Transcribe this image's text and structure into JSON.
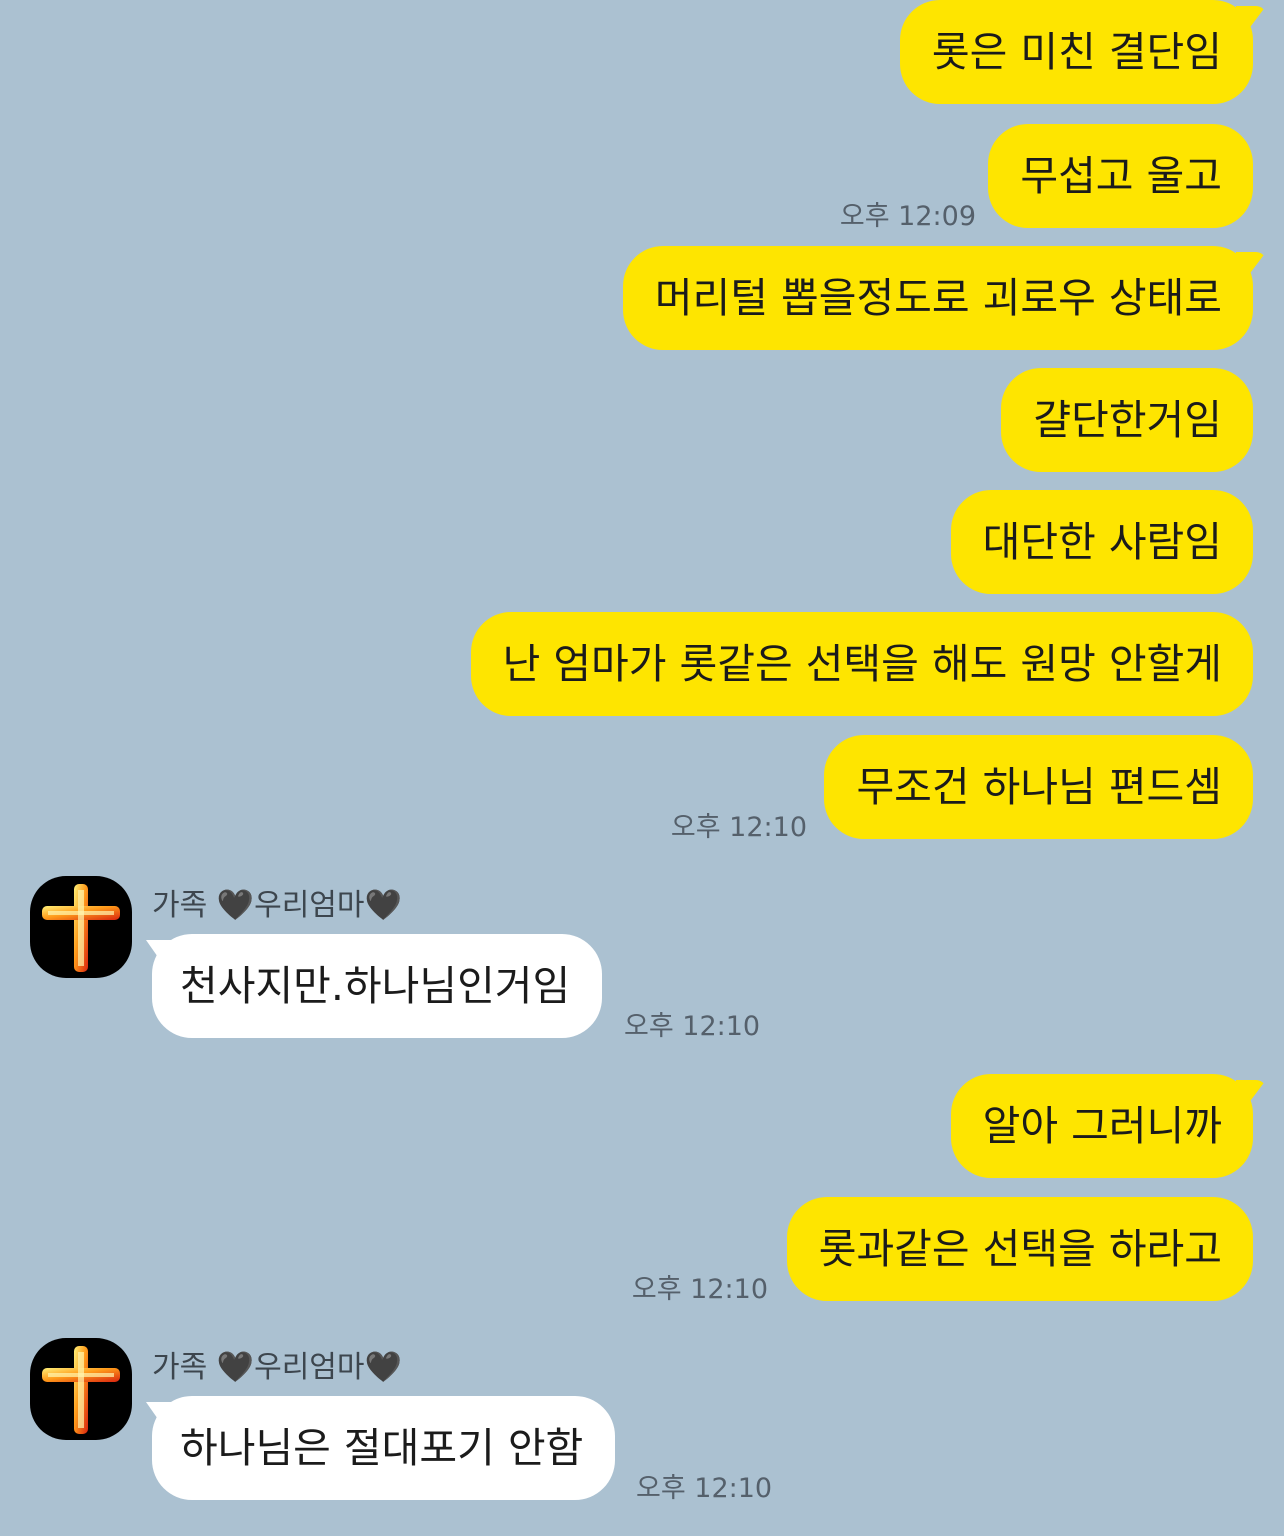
{
  "chat": {
    "accent_colors": {
      "background": "#abc1d1",
      "my_bubble": "#fee500",
      "their_bubble": "#ffffff"
    },
    "messages": [
      {
        "sender": "me",
        "text": "롯은 미친 결단임"
      },
      {
        "sender": "me",
        "text": "무섭고 울고",
        "time": "오후 12:09"
      },
      {
        "sender": "me",
        "text": "머리털 뽑을정도로 괴로우 상태로"
      },
      {
        "sender": "me",
        "text": "걀단한거임"
      },
      {
        "sender": "me",
        "text": "대단한 사람임"
      },
      {
        "sender": "me",
        "text": "난 엄마가 롯같은 선택을 해도 원망 안할게"
      },
      {
        "sender": "me",
        "text": "무조건 하나님 편드셈",
        "time": "오후 12:10"
      },
      {
        "sender": "other",
        "name": "가족 🖤우리엄마🖤",
        "avatar_icon": "fire-cross-icon",
        "text": "천사지만.하나님인거임",
        "time": "오후 12:10"
      },
      {
        "sender": "me",
        "text": "알아 그러니까"
      },
      {
        "sender": "me",
        "text": "롯과같은 선택을 하라고",
        "time": "오후 12:10"
      },
      {
        "sender": "other",
        "name": "가족 🖤우리엄마🖤",
        "avatar_icon": "fire-cross-icon",
        "text": "하나님은 절대포기 안함",
        "time": "오후 12:10"
      }
    ]
  }
}
